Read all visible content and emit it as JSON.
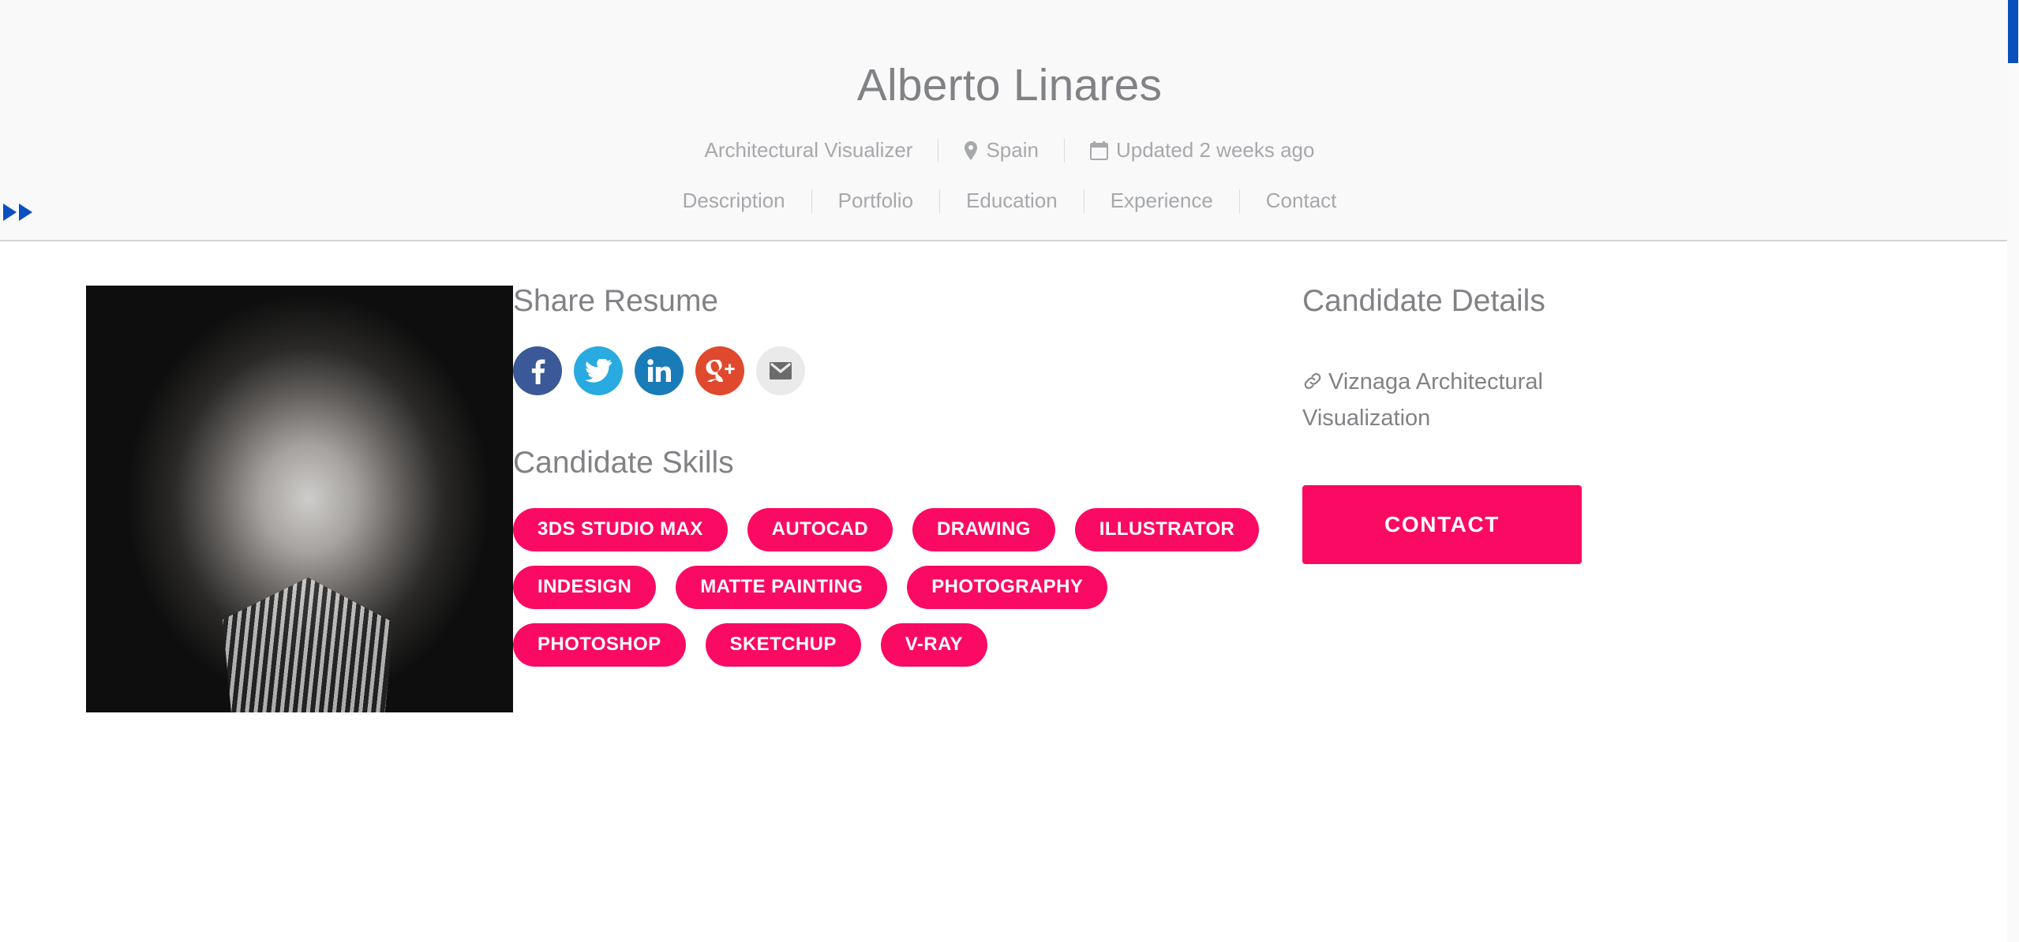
{
  "theme": {
    "accent_pink": "#fb0a63",
    "text_gray": "#808285",
    "muted_gray": "#a6a8ab",
    "header_bg": "#f9f9f9",
    "scroll_blue": "#0a4fbd"
  },
  "header": {
    "name": "Alberto Linares",
    "meta": [
      {
        "icon": "none",
        "label": "Architectural Visualizer"
      },
      {
        "icon": "location-pin-icon",
        "label": "Spain"
      },
      {
        "icon": "calendar-icon",
        "label": "Updated 2 weeks ago"
      }
    ],
    "nav": [
      {
        "label": "Description"
      },
      {
        "label": "Portfolio"
      },
      {
        "label": "Education"
      },
      {
        "label": "Experience"
      },
      {
        "label": "Contact"
      }
    ]
  },
  "photo": {
    "alt": "Alberto Linares portrait"
  },
  "share": {
    "title": "Share Resume",
    "buttons": [
      {
        "name": "facebook",
        "icon": "facebook-icon",
        "color": "#3b5998"
      },
      {
        "name": "twitter",
        "icon": "twitter-icon",
        "color": "#29aae1"
      },
      {
        "name": "linkedin",
        "icon": "linkedin-icon",
        "color": "#1a7bb9"
      },
      {
        "name": "googleplus",
        "icon": "google-plus-icon",
        "color": "#e0492d"
      },
      {
        "name": "email",
        "icon": "email-icon",
        "color": "#eaeaea"
      }
    ]
  },
  "skills": {
    "title": "Candidate Skills",
    "tags": [
      "3DS STUDIO MAX",
      "AUTOCAD",
      "DRAWING",
      "ILLUSTRATOR",
      "INDESIGN",
      "MATTE PAINTING",
      "PHOTOGRAPHY",
      "PHOTOSHOP",
      "SKETCHUP",
      "V-RAY"
    ]
  },
  "details": {
    "title": "Candidate Details",
    "link_icon": "link-icon",
    "link_text": "Viznaga Architectural Visualization",
    "contact_label": "CONTACT"
  },
  "chrome": {
    "edge_arrow_icon": "fast-forward-arrows-icon",
    "scrollbar": "vertical-scrollbar"
  }
}
